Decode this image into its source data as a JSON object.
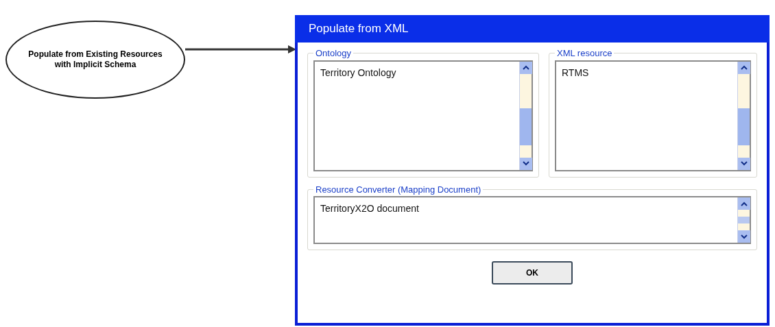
{
  "diagram_node": {
    "label": "Populate from Existing Resources with Implicit Schema"
  },
  "dialog": {
    "title": "Populate from XML",
    "groups": [
      {
        "legend": "Ontology",
        "items": [
          "Territory Ontology"
        ]
      },
      {
        "legend": "XML resource",
        "items": [
          "RTMS"
        ]
      },
      {
        "legend": "Resource Converter (Mapping Document)",
        "items": [
          "TerritoryX2O document"
        ]
      }
    ],
    "buttons": [
      "OK"
    ]
  }
}
